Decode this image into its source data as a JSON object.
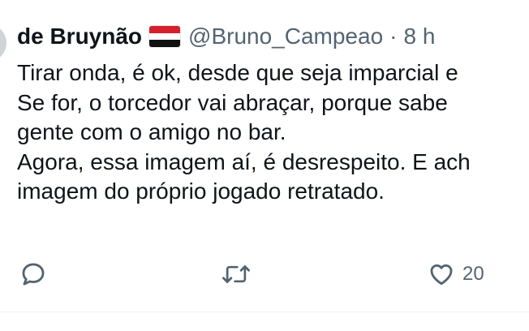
{
  "tweet": {
    "display_name": "de Bruynão",
    "flag_icon": "yemen-flag-icon",
    "handle": "@Bruno_Campeao",
    "separator": "·",
    "time": "8 h",
    "lines": [
      "Tirar onda, é ok, desde que seja imparcial e",
      "Se for, o torcedor vai abraçar, porque sabe",
      "gente com o amigo no bar.",
      "Agora, essa imagem aí, é desrespeito. E ach",
      "imagem do próprio jogado retratado."
    ]
  },
  "actions": {
    "reply_icon": "reply-icon",
    "retweet_icon": "retweet-icon",
    "like_icon": "heart-icon",
    "like_count": "20"
  },
  "colors": {
    "text": "#0f1419",
    "secondary": "#536471",
    "flag_red": "#d5202b",
    "flag_white": "#ffffff",
    "flag_black": "#111111"
  }
}
